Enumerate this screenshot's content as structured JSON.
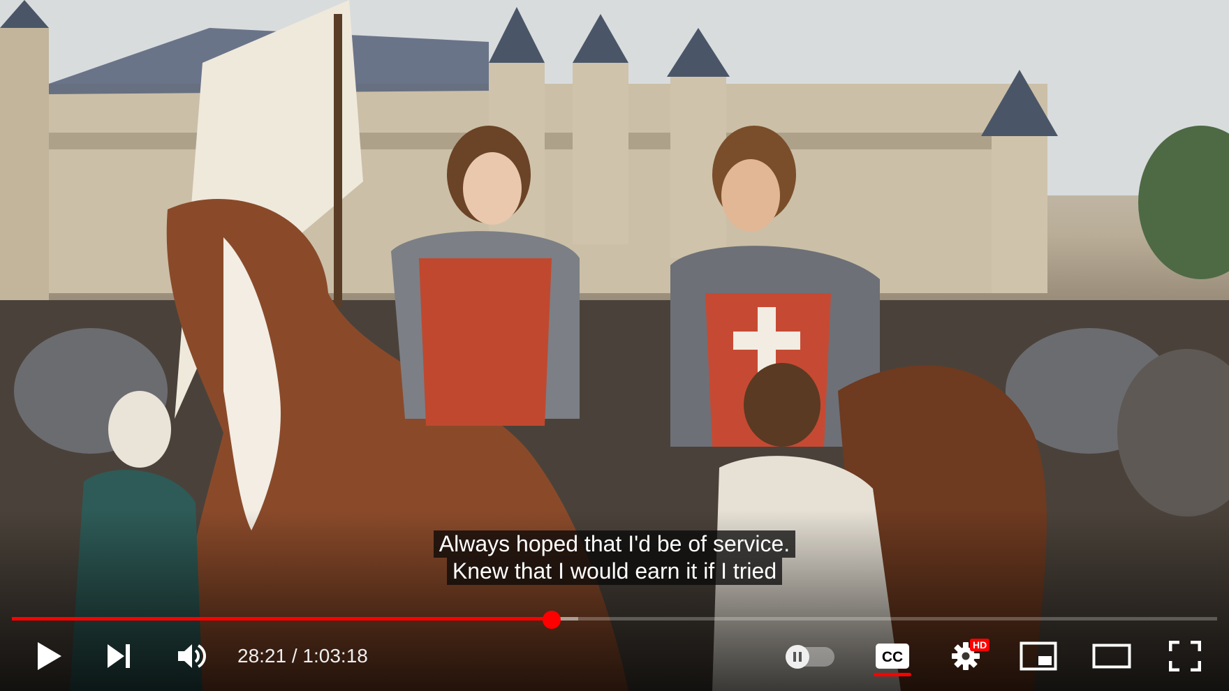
{
  "captions": {
    "line1": "Always hoped that I'd be of service.",
    "line2": "Knew that I would earn it if I tried"
  },
  "progress": {
    "played_fraction": 0.448,
    "loaded_fraction": 0.47
  },
  "time": {
    "current": "28:21",
    "separator": " / ",
    "duration": "1:03:18"
  },
  "settings": {
    "quality_badge": "HD"
  },
  "icons": {
    "play": "play-icon",
    "next": "next-icon",
    "volume": "volume-icon",
    "autoplay": "pause-icon",
    "subtitles": "cc-icon",
    "settings": "gear-icon",
    "miniplayer": "miniplayer-icon",
    "theater": "theater-icon",
    "fullscreen": "fullscreen-icon"
  },
  "colors": {
    "accent": "#ff0000",
    "control": "#ffffff"
  }
}
